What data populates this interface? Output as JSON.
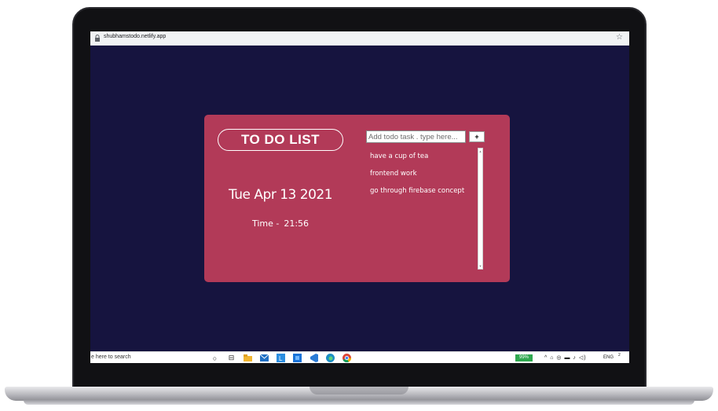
{
  "browser": {
    "url": "shubhamstodo.netlify.app"
  },
  "app": {
    "title": "TO DO LIST",
    "date": "Tue Apr 13 2021",
    "time_label": "Time -",
    "time_value": "21:56",
    "input_placeholder": "Add todo task . type here...",
    "add_button_label": "+",
    "todos": [
      "have a cup of tea",
      "frontend work",
      "go through firebase concept"
    ]
  },
  "taskbar": {
    "search_text": "e here to search",
    "battery_text": "99%",
    "language": "ENG",
    "clock": "2"
  },
  "colors": {
    "background": "#16143f",
    "card": "#b23a58"
  },
  "icons": [
    "lock-icon",
    "star-icon",
    "cortana-icon",
    "task-view-icon",
    "file-explorer-icon",
    "mail-icon",
    "app-l-icon",
    "store-icon",
    "vscode-icon",
    "edge-icon",
    "chrome-icon"
  ]
}
